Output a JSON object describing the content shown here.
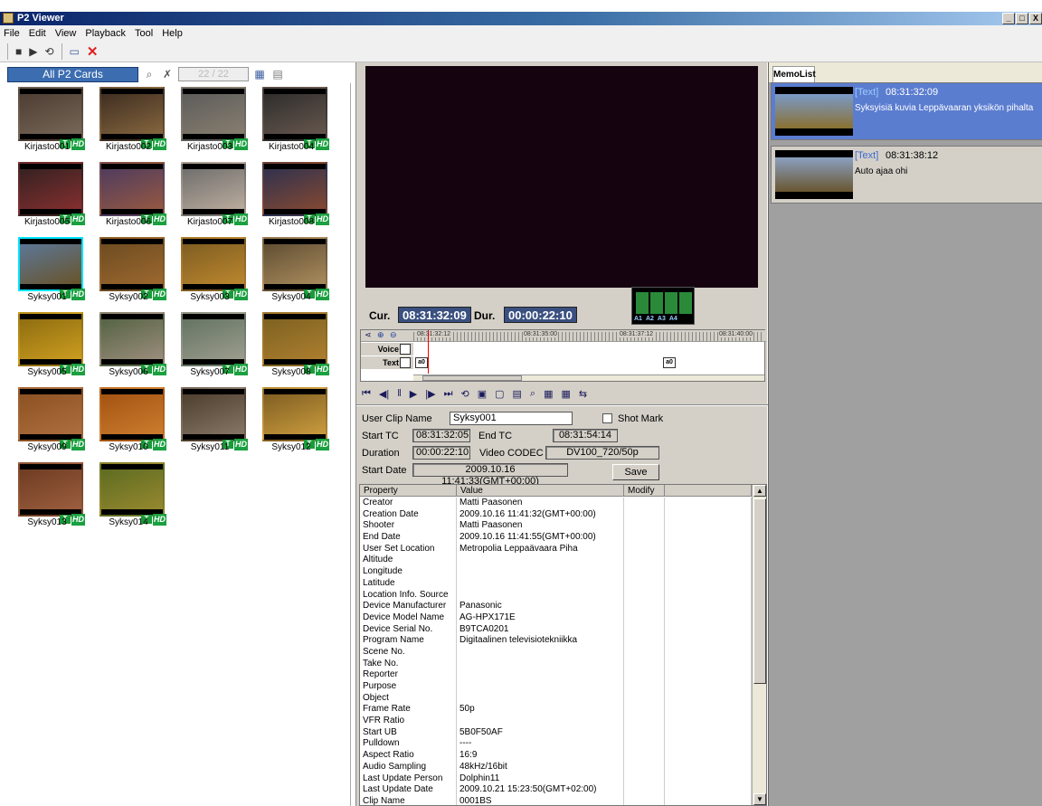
{
  "window": {
    "title": "P2 Viewer",
    "controls": [
      "_",
      "□",
      "X"
    ]
  },
  "menu": [
    "File",
    "Edit",
    "View",
    "Playback",
    "Tool",
    "Help"
  ],
  "toolbar": {
    "icons": [
      "stop-icon",
      "play-icon",
      "loop-icon",
      "window-icon",
      "close-icon"
    ],
    "glyphs": [
      "■",
      "▶",
      "⟲",
      "▭",
      "✕"
    ]
  },
  "left": {
    "cards_label": "All P2 Cards",
    "counter": "22 / 22"
  },
  "clips": [
    {
      "name": "Kirjasto001",
      "colors": [
        "#4a3a30",
        "#7a6a5a"
      ]
    },
    {
      "name": "Kirjasto002",
      "colors": [
        "#3a2a20",
        "#8a6a40"
      ]
    },
    {
      "name": "Kirjasto003",
      "colors": [
        "#5a5a5a",
        "#8a8070"
      ]
    },
    {
      "name": "Kirjasto004",
      "colors": [
        "#2a2a2a",
        "#6a5a50"
      ]
    },
    {
      "name": "Kirjasto005",
      "colors": [
        "#302020",
        "#8a3030"
      ]
    },
    {
      "name": "Kirjasto006",
      "colors": [
        "#4a3a60",
        "#9a5a40"
      ]
    },
    {
      "name": "Kirjasto007",
      "colors": [
        "#6a6a6a",
        "#c0b0a0"
      ]
    },
    {
      "name": "Kirjasto008",
      "colors": [
        "#2a3050",
        "#8a4a30"
      ]
    },
    {
      "name": "Syksy001",
      "colors": [
        "#5a7aa0",
        "#6a5020"
      ],
      "selected": true
    },
    {
      "name": "Syksy002",
      "colors": [
        "#6a4a20",
        "#a06a30"
      ]
    },
    {
      "name": "Syksy003",
      "colors": [
        "#7a5a20",
        "#c08a30"
      ]
    },
    {
      "name": "Syksy004",
      "colors": [
        "#5a4a30",
        "#b09060"
      ]
    },
    {
      "name": "Syksy005",
      "colors": [
        "#8a6a10",
        "#d0a020"
      ]
    },
    {
      "name": "Syksy006",
      "colors": [
        "#506040",
        "#a09080"
      ]
    },
    {
      "name": "Syksy007",
      "colors": [
        "#607060",
        "#a0a090"
      ]
    },
    {
      "name": "Syksy008",
      "colors": [
        "#7a6020",
        "#b08030"
      ]
    },
    {
      "name": "Syksy009",
      "colors": [
        "#8a5020",
        "#b07040"
      ]
    },
    {
      "name": "Syksy010",
      "colors": [
        "#a05010",
        "#d08030"
      ]
    },
    {
      "name": "Syksy011",
      "colors": [
        "#4a3a2a",
        "#8a7a6a"
      ]
    },
    {
      "name": "Syksy012",
      "colors": [
        "#7a5a20",
        "#d0a040"
      ]
    },
    {
      "name": "Syksy013",
      "colors": [
        "#6a3a20",
        "#a06040"
      ]
    },
    {
      "name": "Syksy014",
      "colors": [
        "#5a6a20",
        "#9a8a30"
      ]
    }
  ],
  "badges": {
    "t": "T",
    "hd": "HD"
  },
  "player": {
    "cur_label": "Cur.",
    "cur": "08:31:32:09",
    "dur_label": "Dur.",
    "dur": "00:00:22:10",
    "meter_labels": [
      "A1",
      "A2",
      "A3",
      "A4"
    ]
  },
  "timeline": {
    "ticks": [
      "08:31:32:12",
      "08:31:35:00",
      "08:31:37:12",
      "08:31:40:00"
    ],
    "tracks": [
      "Voice",
      "Text"
    ],
    "marker": "a0"
  },
  "transport": [
    "⏮",
    "◀|",
    "‖",
    "▶",
    "|▶",
    "⏭",
    "⟲",
    "▣",
    "▢",
    "▤",
    "⌕",
    "▦",
    "▦",
    "⇆"
  ],
  "clipinfo": {
    "user_clip_name_label": "User Clip Name",
    "user_clip_name": "Syksy001",
    "shot_mark_label": "Shot Mark",
    "start_tc_label": "Start TC",
    "start_tc": "08:31:32:05",
    "end_tc_label": "End TC",
    "end_tc": "08:31:54:14",
    "duration_label": "Duration",
    "duration": "00:00:22:10",
    "codec_label": "Video CODEC",
    "codec": "DV100_720/50p",
    "start_date_label": "Start Date",
    "start_date": "2009.10.16 11:41:33(GMT+00:00)",
    "save_label": "Save"
  },
  "properties": {
    "headers": [
      "Property",
      "Value",
      "Modify"
    ],
    "rows": [
      [
        "Creator",
        "Matti Paasonen"
      ],
      [
        "Creation Date",
        "2009.10.16 11:41:32(GMT+00:00)"
      ],
      [
        "Shooter",
        "Matti Paasonen"
      ],
      [
        "End Date",
        "2009.10.16 11:41:55(GMT+00:00)"
      ],
      [
        "User Set Location",
        "Metropolia Leppaävaara Piha"
      ],
      [
        "Altitude",
        ""
      ],
      [
        "Longitude",
        ""
      ],
      [
        "Latitude",
        ""
      ],
      [
        "Location Info. Source",
        ""
      ],
      [
        "Device Manufacturer",
        "Panasonic"
      ],
      [
        "Device Model Name",
        "AG-HPX171E"
      ],
      [
        "Device Serial No.",
        "B9TCA0201"
      ],
      [
        "Program Name",
        "Digitaalinen televisiotekniikka"
      ],
      [
        "Scene No.",
        ""
      ],
      [
        "Take No.",
        ""
      ],
      [
        "Reporter",
        ""
      ],
      [
        "Purpose",
        ""
      ],
      [
        "Object",
        ""
      ],
      [
        "Frame Rate",
        "50p"
      ],
      [
        "VFR Ratio",
        ""
      ],
      [
        "Start UB",
        "5B0F50AF"
      ],
      [
        "Pulldown",
        "----"
      ],
      [
        "Aspect Ratio",
        "16:9"
      ],
      [
        "Audio Sampling",
        "48kHz/16bit"
      ],
      [
        "Last Update Person",
        "Dolphin11"
      ],
      [
        "Last Update Date",
        "2009.10.21 15:23:50(GMT+02:00)"
      ],
      [
        "Clip Name",
        "0001BS"
      ]
    ]
  },
  "memolist": {
    "tab": "MemoList",
    "items": [
      {
        "type": "[Text]",
        "tc": "08:31:32:09",
        "text": "Syksyisiä kuvia Leppävaaran yksikön pihalta"
      },
      {
        "type": "[Text]",
        "tc": "08:31:38:12",
        "text": "Auto ajaa ohi"
      }
    ]
  }
}
